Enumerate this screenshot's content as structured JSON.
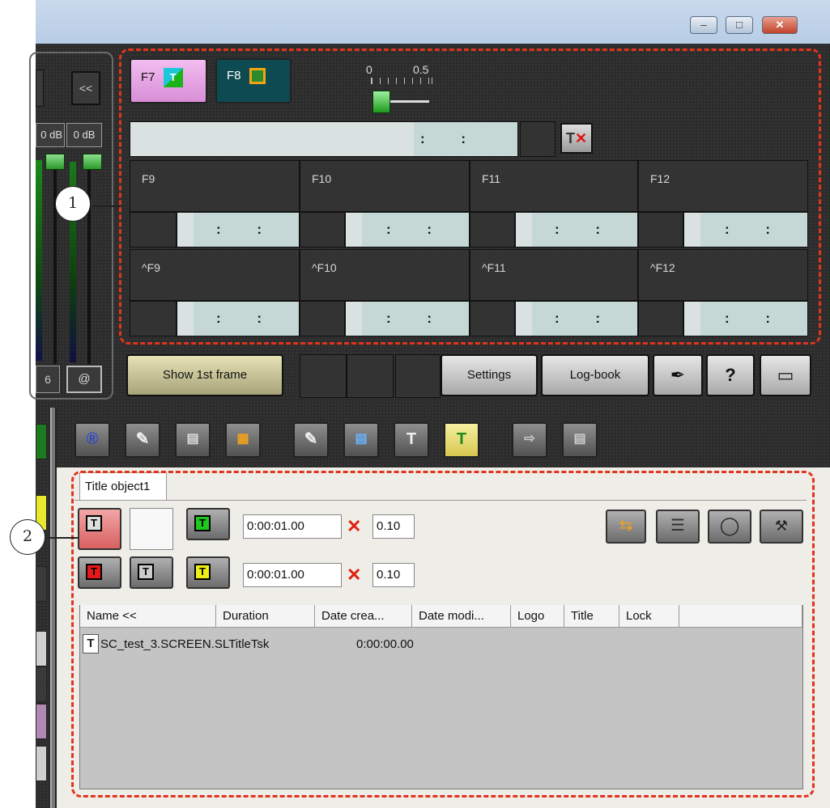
{
  "window": {
    "minimize_glyph": "–",
    "maximize_glyph": "□",
    "close_glyph": "✕"
  },
  "left_strip": {
    "collapse_label": "<<",
    "db_left": "0 dB",
    "db_right": "0 dB",
    "six_label": "6",
    "at_label": "@"
  },
  "callouts": {
    "one": "1",
    "two": "2"
  },
  "top_panel": {
    "f7_label": "F7",
    "f8_label": "F8",
    "slider_min": "0",
    "slider_mid": "0.5",
    "slider_value": 0,
    "main_time": ": :",
    "cells": [
      {
        "label": "F9",
        "time": ": :"
      },
      {
        "label": "F10",
        "time": ": :"
      },
      {
        "label": "F11",
        "time": ": :"
      },
      {
        "label": "F12",
        "time": ": :"
      },
      {
        "label": "^F9",
        "time": ": :"
      },
      {
        "label": "^F10",
        "time": ": :"
      },
      {
        "label": "^F11",
        "time": ": :"
      },
      {
        "label": "^F12",
        "time": ": :"
      }
    ]
  },
  "buttons": {
    "show_first_frame": "Show 1st frame",
    "settings": "Settings",
    "log_book": "Log-book"
  },
  "title_panel": {
    "tab_label": "Title object1",
    "row1_time": "0:00:01.00",
    "row1_value": "0.10",
    "row2_time": "0:00:01.00",
    "row2_value": "0.10",
    "columns": [
      "Name <<",
      "Duration",
      "Date crea...",
      "Date modi...",
      "Logo",
      "Title",
      "Lock"
    ],
    "rows": [
      {
        "name": "SC_test_3.SCREEN.SLTitleTsk",
        "duration": "0:00:00.00"
      }
    ]
  }
}
